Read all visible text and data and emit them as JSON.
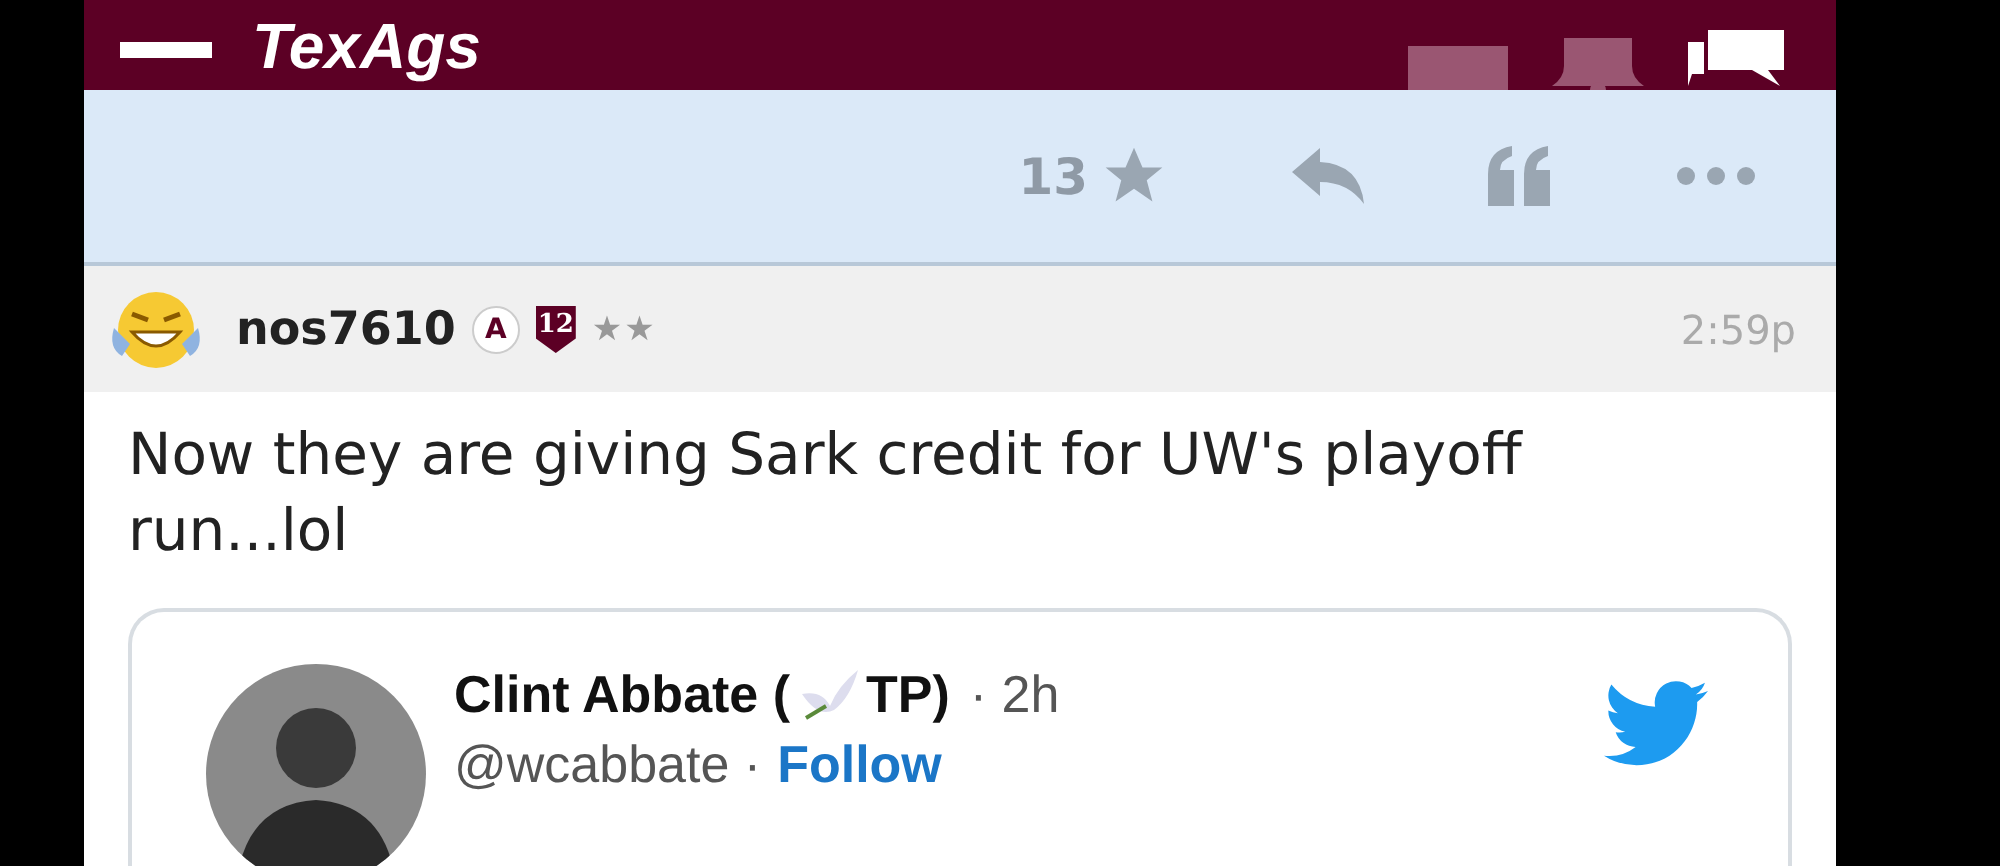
{
  "header": {
    "logo": "TexAgs"
  },
  "action_bar": {
    "likes": "13"
  },
  "post": {
    "username": "nos7610",
    "badges": [
      {
        "kind": "letter",
        "text": "A"
      },
      {
        "kind": "shield",
        "text": "12"
      }
    ],
    "rank_stars": "★★",
    "time": "2:59p",
    "body": "Now they are giving Sark credit for UW's playoff run...lol"
  },
  "tweet": {
    "name_start": "Clint Abbate (",
    "name_end": "TP)",
    "age": "· 2h",
    "handle": "@wcabbate ·",
    "follow": "Follow"
  }
}
